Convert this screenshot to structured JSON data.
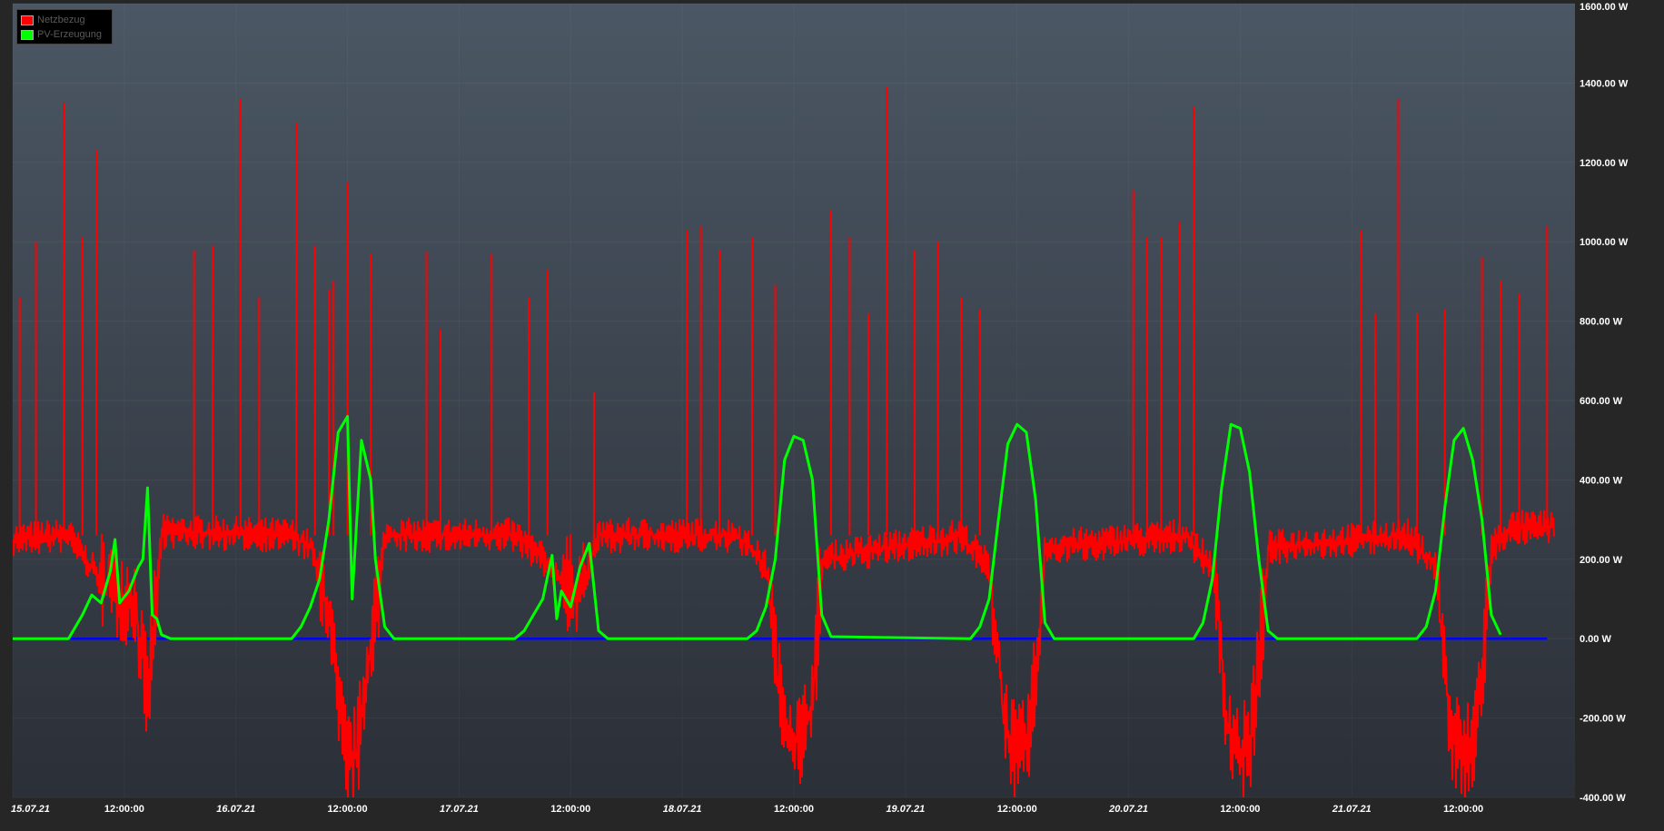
{
  "chart_data": {
    "type": "line",
    "title": "",
    "xlabel": "",
    "ylabel": "",
    "ylim": [
      -400,
      1600
    ],
    "y_unit": "W",
    "y_ticks": [
      {
        "value": 1600,
        "label": "1600.00 W"
      },
      {
        "value": 1400,
        "label": "1400.00 W"
      },
      {
        "value": 1200,
        "label": "1200.00 W"
      },
      {
        "value": 1000,
        "label": "1000.00 W"
      },
      {
        "value": 800,
        "label": "800.00 W"
      },
      {
        "value": 600,
        "label": "600.00 W"
      },
      {
        "value": 400,
        "label": "400.00 W"
      },
      {
        "value": 200,
        "label": "200.00 W"
      },
      {
        "value": 0,
        "label": "0.00 W"
      },
      {
        "value": -200,
        "label": "-200.00 W"
      },
      {
        "value": -400,
        "label": "-400.00 W"
      }
    ],
    "x_range": [
      "15.07.21 00:00",
      "22.07.21 00:00"
    ],
    "x_ticks": [
      {
        "at": "15.07.21 00:00",
        "label": "15.07.21",
        "bold": true
      },
      {
        "at": "15.07.21 12:00",
        "label": "12:00:00",
        "bold": false
      },
      {
        "at": "16.07.21 00:00",
        "label": "16.07.21",
        "bold": true
      },
      {
        "at": "16.07.21 12:00",
        "label": "12:00:00",
        "bold": false
      },
      {
        "at": "17.07.21 00:00",
        "label": "17.07.21",
        "bold": true
      },
      {
        "at": "17.07.21 12:00",
        "label": "12:00:00",
        "bold": false
      },
      {
        "at": "18.07.21 00:00",
        "label": "18.07.21",
        "bold": true
      },
      {
        "at": "18.07.21 12:00",
        "label": "12:00:00",
        "bold": false
      },
      {
        "at": "19.07.21 00:00",
        "label": "19.07.21",
        "bold": true
      },
      {
        "at": "19.07.21 12:00",
        "label": "12:00:00",
        "bold": false
      },
      {
        "at": "20.07.21 00:00",
        "label": "20.07.21",
        "bold": true
      },
      {
        "at": "20.07.21 12:00",
        "label": "12:00:00",
        "bold": false
      },
      {
        "at": "21.07.21 00:00",
        "label": "21.07.21",
        "bold": true
      },
      {
        "at": "21.07.21 12:00",
        "label": "12:00:00",
        "bold": false
      }
    ],
    "grid": true,
    "legend_position": "top-left",
    "legend": [
      {
        "name": "Netzbezug",
        "color": "#ff0000"
      },
      {
        "name": "PV-Erzeugung",
        "color": "#00ff00"
      }
    ],
    "colors": {
      "netzbezug": "#ff0000",
      "pv": "#00ff00",
      "zero_line": "#0000ff",
      "plot_bg_top": "#4b5764",
      "plot_bg_bottom": "#2b2f37"
    },
    "series": [
      {
        "name": "PV-Erzeugung",
        "points": [
          [
            "15.07.21 00:00",
            0
          ],
          [
            "15.07.21 06:00",
            0
          ],
          [
            "15.07.21 06:30",
            20
          ],
          [
            "15.07.21 07:30",
            60
          ],
          [
            "15.07.21 08:30",
            110
          ],
          [
            "15.07.21 09:30",
            90
          ],
          [
            "15.07.21 10:30",
            170
          ],
          [
            "15.07.21 11:00",
            250
          ],
          [
            "15.07.21 11:30",
            90
          ],
          [
            "15.07.21 12:30",
            120
          ],
          [
            "15.07.21 13:30",
            180
          ],
          [
            "15.07.21 14:00",
            200
          ],
          [
            "15.07.21 14:30",
            380
          ],
          [
            "15.07.21 15:00",
            60
          ],
          [
            "15.07.21 15:30",
            50
          ],
          [
            "15.07.21 16:00",
            10
          ],
          [
            "15.07.21 17:00",
            0
          ],
          [
            "16.07.21 06:00",
            0
          ],
          [
            "16.07.21 07:00",
            30
          ],
          [
            "16.07.21 08:00",
            80
          ],
          [
            "16.07.21 09:00",
            150
          ],
          [
            "16.07.21 10:00",
            300
          ],
          [
            "16.07.21 11:00",
            520
          ],
          [
            "16.07.21 12:00",
            560
          ],
          [
            "16.07.21 12:30",
            100
          ],
          [
            "16.07.21 13:30",
            500
          ],
          [
            "16.07.21 14:30",
            400
          ],
          [
            "16.07.21 15:00",
            200
          ],
          [
            "16.07.21 16:00",
            30
          ],
          [
            "16.07.21 17:00",
            0
          ],
          [
            "17.07.21 06:00",
            0
          ],
          [
            "17.07.21 07:00",
            20
          ],
          [
            "17.07.21 08:00",
            60
          ],
          [
            "17.07.21 09:00",
            100
          ],
          [
            "17.07.21 10:00",
            210
          ],
          [
            "17.07.21 10:30",
            50
          ],
          [
            "17.07.21 11:00",
            120
          ],
          [
            "17.07.21 12:00",
            80
          ],
          [
            "17.07.21 13:00",
            180
          ],
          [
            "17.07.21 14:00",
            240
          ],
          [
            "17.07.21 15:00",
            20
          ],
          [
            "17.07.21 16:00",
            0
          ],
          [
            "18.07.21 07:00",
            0
          ],
          [
            "18.07.21 08:00",
            20
          ],
          [
            "18.07.21 09:00",
            80
          ],
          [
            "18.07.21 10:00",
            200
          ],
          [
            "18.07.21 11:00",
            450
          ],
          [
            "18.07.21 12:00",
            510
          ],
          [
            "18.07.21 13:00",
            500
          ],
          [
            "18.07.21 14:00",
            400
          ],
          [
            "18.07.21 15:00",
            60
          ],
          [
            "18.07.21 16:00",
            5
          ],
          [
            "19.07.21 07:00",
            0
          ],
          [
            "19.07.21 08:00",
            30
          ],
          [
            "19.07.21 09:00",
            100
          ],
          [
            "19.07.21 10:00",
            300
          ],
          [
            "19.07.21 11:00",
            490
          ],
          [
            "19.07.21 12:00",
            540
          ],
          [
            "19.07.21 13:00",
            520
          ],
          [
            "19.07.21 14:00",
            350
          ],
          [
            "19.07.21 15:00",
            40
          ],
          [
            "19.07.21 16:00",
            0
          ],
          [
            "20.07.21 07:00",
            0
          ],
          [
            "20.07.21 08:00",
            40
          ],
          [
            "20.07.21 09:00",
            150
          ],
          [
            "20.07.21 10:00",
            380
          ],
          [
            "20.07.21 11:00",
            540
          ],
          [
            "20.07.21 12:00",
            530
          ],
          [
            "20.07.21 13:00",
            420
          ],
          [
            "20.07.21 14:00",
            200
          ],
          [
            "20.07.21 15:00",
            20
          ],
          [
            "20.07.21 16:00",
            0
          ],
          [
            "21.07.21 07:00",
            0
          ],
          [
            "21.07.21 08:00",
            30
          ],
          [
            "21.07.21 09:00",
            120
          ],
          [
            "21.07.21 10:00",
            330
          ],
          [
            "21.07.21 11:00",
            500
          ],
          [
            "21.07.21 12:00",
            530
          ],
          [
            "21.07.21 13:00",
            450
          ],
          [
            "21.07.21 14:00",
            300
          ],
          [
            "21.07.21 15:00",
            60
          ],
          [
            "21.07.21 16:00",
            10
          ]
        ]
      },
      {
        "name": "Netzbezug",
        "points": [
          [
            "15.07.21 00:00",
            250
          ],
          [
            "15.07.21 06:00",
            260
          ],
          [
            "15.07.21 09:00",
            160
          ],
          [
            "15.07.21 11:00",
            120
          ],
          [
            "15.07.21 13:00",
            100
          ],
          [
            "15.07.21 14:30",
            -150
          ],
          [
            "15.07.21 16:00",
            270
          ],
          [
            "16.07.21 06:00",
            260
          ],
          [
            "16.07.21 08:00",
            230
          ],
          [
            "16.07.21 10:00",
            60
          ],
          [
            "16.07.21 11:00",
            -180
          ],
          [
            "16.07.21 12:00",
            -310
          ],
          [
            "16.07.21 13:00",
            -290
          ],
          [
            "16.07.21 14:00",
            -100
          ],
          [
            "16.07.21 16:00",
            260
          ],
          [
            "17.07.21 06:00",
            260
          ],
          [
            "17.07.21 09:00",
            200
          ],
          [
            "17.07.21 11:00",
            150
          ],
          [
            "17.07.21 13:00",
            120
          ],
          [
            "17.07.21 15:00",
            260
          ],
          [
            "18.07.21 06:00",
            260
          ],
          [
            "18.07.21 09:00",
            180
          ],
          [
            "18.07.21 10:30",
            -150
          ],
          [
            "18.07.21 12:00",
            -260
          ],
          [
            "18.07.21 13:00",
            -250
          ],
          [
            "18.07.21 14:00",
            -150
          ],
          [
            "18.07.21 15:00",
            200
          ],
          [
            "19.07.21 06:00",
            260
          ],
          [
            "19.07.21 09:00",
            180
          ],
          [
            "19.07.21 10:30",
            -200
          ],
          [
            "19.07.21 12:00",
            -300
          ],
          [
            "19.07.21 13:00",
            -270
          ],
          [
            "19.07.21 14:00",
            -100
          ],
          [
            "19.07.21 15:00",
            230
          ],
          [
            "20.07.21 06:00",
            260
          ],
          [
            "20.07.21 09:00",
            180
          ],
          [
            "20.07.21 10:30",
            -200
          ],
          [
            "20.07.21 12:00",
            -300
          ],
          [
            "20.07.21 13:00",
            -260
          ],
          [
            "20.07.21 14:00",
            -50
          ],
          [
            "20.07.21 15:00",
            230
          ],
          [
            "21.07.21 06:00",
            260
          ],
          [
            "21.07.21 09:00",
            180
          ],
          [
            "21.07.21 10:30",
            -220
          ],
          [
            "21.07.21 12:00",
            -300
          ],
          [
            "21.07.21 13:00",
            -260
          ],
          [
            "21.07.21 14:00",
            -80
          ],
          [
            "21.07.21 15:00",
            230
          ],
          [
            "21.07.21 17:00",
            280
          ]
        ],
        "spikes": [
          [
            "15.07.21 00:45",
            860
          ],
          [
            "15.07.21 02:30",
            1000
          ],
          [
            "15.07.21 05:30",
            1350
          ],
          [
            "15.07.21 07:30",
            1010
          ],
          [
            "15.07.21 09:00",
            1230
          ],
          [
            "15.07.21 19:30",
            980
          ],
          [
            "15.07.21 21:30",
            990
          ],
          [
            "16.07.21 00:30",
            1360
          ],
          [
            "16.07.21 02:30",
            860
          ],
          [
            "16.07.21 06:30",
            1300
          ],
          [
            "16.07.21 08:30",
            990
          ],
          [
            "16.07.21 10:00",
            880
          ],
          [
            "16.07.21 10:30",
            900
          ],
          [
            "16.07.21 12:00",
            1150
          ],
          [
            "16.07.21 14:30",
            970
          ],
          [
            "16.07.21 20:30",
            975
          ],
          [
            "16.07.21 22:00",
            780
          ],
          [
            "17.07.21 03:30",
            970
          ],
          [
            "17.07.21 07:30",
            860
          ],
          [
            "17.07.21 09:30",
            930
          ],
          [
            "17.07.21 14:30",
            620
          ],
          [
            "18.07.21 00:30",
            1030
          ],
          [
            "18.07.21 02:00",
            1040
          ],
          [
            "18.07.21 04:00",
            980
          ],
          [
            "18.07.21 07:30",
            1010
          ],
          [
            "18.07.21 10:00",
            890
          ],
          [
            "18.07.21 16:00",
            1080
          ],
          [
            "18.07.21 18:00",
            1010
          ],
          [
            "18.07.21 20:00",
            820
          ],
          [
            "18.07.21 22:00",
            1390
          ],
          [
            "19.07.21 01:00",
            980
          ],
          [
            "19.07.21 03:30",
            1000
          ],
          [
            "19.07.21 06:00",
            860
          ],
          [
            "19.07.21 08:00",
            830
          ],
          [
            "20.07.21 00:30",
            1130
          ],
          [
            "20.07.21 02:00",
            1010
          ],
          [
            "20.07.21 03:30",
            1010
          ],
          [
            "20.07.21 05:30",
            1050
          ],
          [
            "20.07.21 07:00",
            1340
          ],
          [
            "21.07.21 01:00",
            1030
          ],
          [
            "21.07.21 02:30",
            820
          ],
          [
            "21.07.21 05:00",
            1360
          ],
          [
            "21.07.21 07:00",
            820
          ],
          [
            "21.07.21 10:00",
            830
          ],
          [
            "21.07.21 14:00",
            960
          ],
          [
            "21.07.21 16:00",
            900
          ],
          [
            "21.07.21 18:00",
            870
          ],
          [
            "21.07.21 21:00",
            1040
          ]
        ]
      },
      {
        "name": "",
        "color": "#0000ff",
        "points": [
          [
            "15.07.21 00:00",
            0
          ],
          [
            "21.07.21 21:00",
            0
          ]
        ]
      }
    ]
  }
}
